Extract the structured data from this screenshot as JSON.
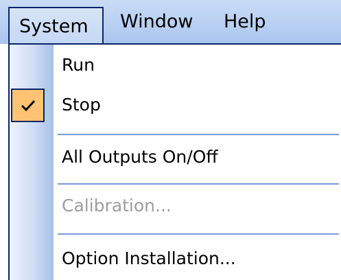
{
  "menubar": {
    "items": [
      {
        "label": "System"
      },
      {
        "label": "Window"
      },
      {
        "label": "Help"
      }
    ]
  },
  "system_menu": {
    "items": [
      {
        "label": "Run",
        "checked": false,
        "enabled": true
      },
      {
        "label": "Stop",
        "checked": true,
        "enabled": true
      },
      {
        "label": "All Outputs On/Off",
        "checked": false,
        "enabled": true
      },
      {
        "label": "Calibration...",
        "checked": false,
        "enabled": false
      },
      {
        "label": "Option Installation...",
        "checked": false,
        "enabled": true
      }
    ]
  },
  "colors": {
    "menubar_bg": "#b7cff2",
    "selection_border": "#0a246a",
    "check_highlight": "#ffc373",
    "separator": "#7a9ad8",
    "disabled_text": "#9d9d9d"
  },
  "icons": {
    "check": "checkmark-icon"
  }
}
